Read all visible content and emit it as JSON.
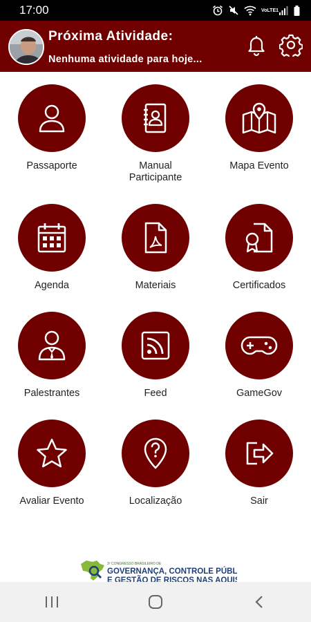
{
  "status_bar": {
    "time": "17:00",
    "icons": [
      "alarm-icon",
      "mute-icon",
      "wifi-icon",
      "volte-lte-icon",
      "signal-icon",
      "battery-icon"
    ],
    "network_label": "VoLTE1"
  },
  "header": {
    "title": "Próxima Atividade:",
    "subtitle": "Nenhuma atividade para hoje...",
    "background": "#700000",
    "icons": [
      "bell-icon",
      "gear-icon"
    ]
  },
  "menu": {
    "accent": "#700000",
    "items": [
      {
        "label": "Passaporte",
        "icon": "user-icon"
      },
      {
        "label": "Manual\nParticipante",
        "icon": "address-book-icon"
      },
      {
        "label": "Mapa Evento",
        "icon": "map-icon"
      },
      {
        "label": "Agenda",
        "icon": "calendar-icon"
      },
      {
        "label": "Materiais",
        "icon": "pdf-file-icon"
      },
      {
        "label": "Certificados",
        "icon": "certificate-icon"
      },
      {
        "label": "Palestrantes",
        "icon": "speaker-icon"
      },
      {
        "label": "Feed",
        "icon": "rss-icon"
      },
      {
        "label": "GameGov",
        "icon": "gamepad-icon"
      },
      {
        "label": "Avaliar Evento",
        "icon": "star-icon"
      },
      {
        "label": "Localização",
        "icon": "location-question-icon"
      },
      {
        "label": "Sair",
        "icon": "exit-icon"
      }
    ]
  },
  "footer_logo": {
    "small_text": "3º CONGRESSO BRASILEIRO DE",
    "line1": "GOVERNANÇA, CONTROLE PÚBLICO",
    "line2": "E GESTÃO DE RISCOS NAS AQUISIÇÕES"
  },
  "nav_bar": {
    "buttons": [
      "recent-apps-icon",
      "home-icon",
      "back-icon"
    ]
  }
}
